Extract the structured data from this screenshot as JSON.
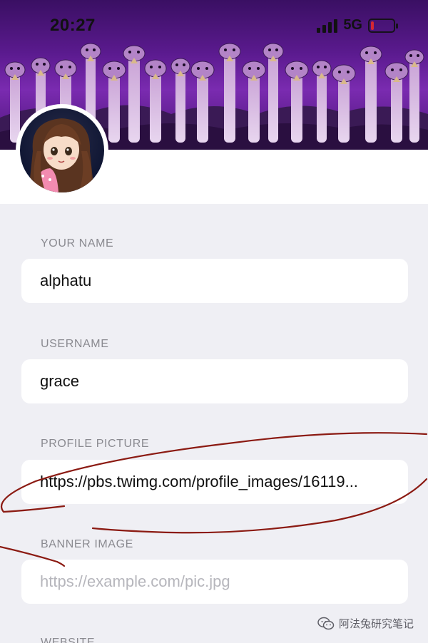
{
  "status_bar": {
    "time": "20:27",
    "network": "5G",
    "battery_color": "#e52b2b"
  },
  "profile": {
    "avatar_icon": "avatar",
    "banner_icon": "banner-image"
  },
  "form": {
    "fields": [
      {
        "label": "YOUR NAME",
        "value": "alphatu",
        "placeholder": ""
      },
      {
        "label": "USERNAME",
        "value": "grace",
        "placeholder": ""
      },
      {
        "label": "PROFILE PICTURE",
        "value": "https://pbs.twimg.com/profile_images/16119...",
        "placeholder": ""
      },
      {
        "label": "BANNER IMAGE",
        "value": "",
        "placeholder": "https://example.com/pic.jpg"
      },
      {
        "label": "WEBSITE",
        "value": "",
        "placeholder": ""
      }
    ]
  },
  "watermark": {
    "text": "阿法兔研究笔记"
  },
  "colors": {
    "page_bg": "#efeff4",
    "banner_purple": "#6a1fa0",
    "annotation_red": "#8b1a12"
  }
}
